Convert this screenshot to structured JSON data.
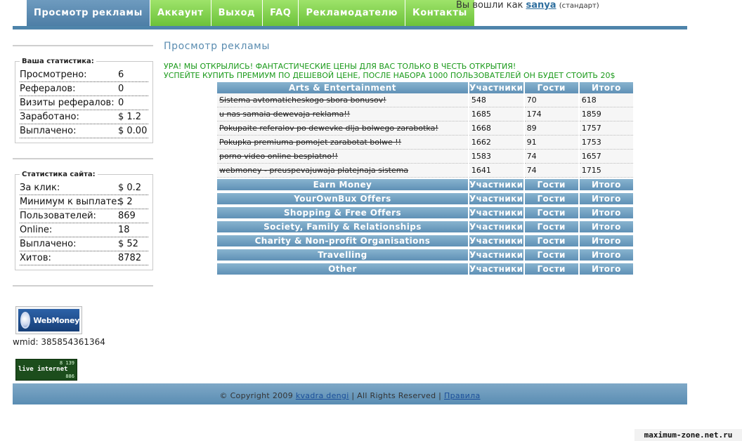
{
  "nav": {
    "tabs": [
      {
        "label": "Просмотр рекламы",
        "active": true
      },
      {
        "label": "Аккаунт"
      },
      {
        "label": "Выход"
      },
      {
        "label": "FAQ"
      },
      {
        "label": "Рекламодателю"
      },
      {
        "label": "Контакты"
      }
    ]
  },
  "login": {
    "prefix": "Вы вошли как",
    "username": "sanya",
    "role": "(стандарт)"
  },
  "user_stats": {
    "title": "Ваша статистика:",
    "rows": [
      {
        "label": "Просмотрено:",
        "value": "6"
      },
      {
        "label": "Рефералов:",
        "value": "0"
      },
      {
        "label": "Визиты рефералов:",
        "value": "0"
      },
      {
        "label": "Заработано:",
        "value": "$ 1.2"
      },
      {
        "label": "Выплачено:",
        "value": "$ 0.00"
      }
    ]
  },
  "site_stats": {
    "title": "Статистика сайта:",
    "rows": [
      {
        "label": "За клик:",
        "value": "$ 0.2"
      },
      {
        "label": "Минимум к выплате:",
        "value": "$ 2"
      },
      {
        "label": "Пользователей:",
        "value": "869"
      },
      {
        "label": "Online:",
        "value": "18"
      },
      {
        "label": "Выплачено:",
        "value": "$ 52"
      },
      {
        "label": "Хитов:",
        "value": "8782"
      }
    ]
  },
  "webmoney": {
    "logo_text": "WebMoney",
    "wmid": "wmid: 385854361364"
  },
  "liveinternet": {
    "label": "live internet",
    "n1": "8 139",
    "n2": "886"
  },
  "page_title": "Просмотр рекламы",
  "promo": [
    "УРА! МЫ ОТКРЫЛИСЬ! ФАНТАСТИЧЕСКИЕ ЦЕНЫ ДЛЯ ВАС ТОЛЬКО В ЧЕСТЬ ОТКРЫТИЯ!",
    "УСПЕЙТЕ КУПИТЬ ПРЕМИУМ ПО ДЕШЕВОЙ ЦЕНЕ, ПОСЛЕ НАБОРА 1000 ПОЛЬЗОВАТЕЛЕЙ ОН БУДЕТ СТОИТЬ 20$"
  ],
  "columns": {
    "participants": "Участники",
    "guests": "Гости",
    "total": "Итого"
  },
  "categories": [
    {
      "name": "Arts & Entertainment",
      "rows": [
        {
          "title": "Sistema avtomaticheskogo sbora bonusov!",
          "participants": "548",
          "guests": "70",
          "total": "618"
        },
        {
          "title": "u nas samaia dewevaja reklama!!",
          "participants": "1685",
          "guests": "174",
          "total": "1859"
        },
        {
          "title": "Pokupaite referalov po dewevke dlja bolwego zarabotka!",
          "participants": "1668",
          "guests": "89",
          "total": "1757"
        },
        {
          "title": "Pokupka premiuma pomojet zarabotat bolwe !!",
          "participants": "1662",
          "guests": "91",
          "total": "1753"
        },
        {
          "title": "porno video online besplatno!!",
          "participants": "1583",
          "guests": "74",
          "total": "1657"
        },
        {
          "title": "webmoney - preuspevajuwaja platejnaja sistema",
          "participants": "1641",
          "guests": "74",
          "total": "1715"
        }
      ]
    },
    {
      "name": "Earn Money",
      "rows": []
    },
    {
      "name": "YourOwnBux Offers",
      "rows": []
    },
    {
      "name": "Shopping & Free Offers",
      "rows": []
    },
    {
      "name": "Society, Family & Relationships",
      "rows": []
    },
    {
      "name": "Charity & Non-profit Organisations",
      "rows": []
    },
    {
      "name": "Travelling",
      "rows": []
    },
    {
      "name": "Other",
      "rows": []
    }
  ],
  "footer": {
    "copyright": "© Copyright 2009",
    "site_link": "kvadra dengi",
    "rights": "| All Rights Reserved |",
    "rules_link": "Правила"
  },
  "watermark": "maximum-zone.net.ru"
}
